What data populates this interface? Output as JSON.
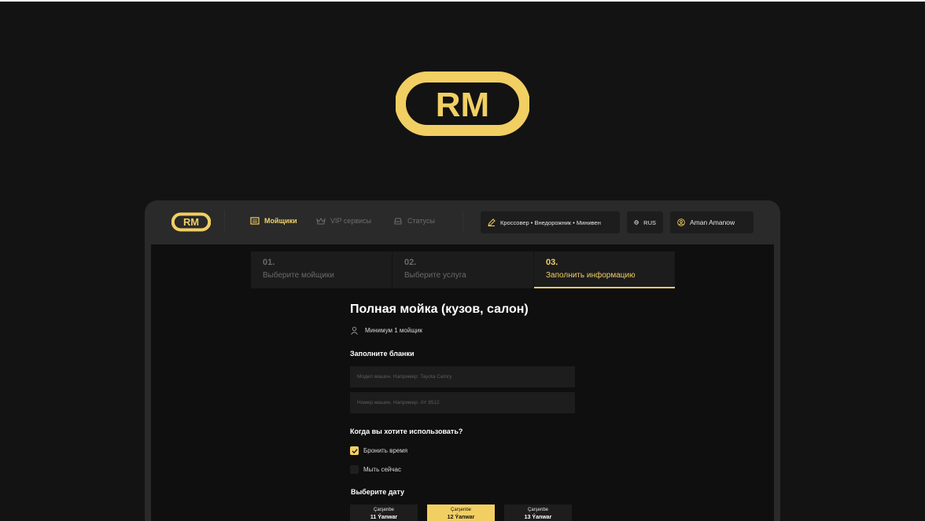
{
  "brand": {
    "logo_text": "RM",
    "accent": "#f2cf63"
  },
  "nav": {
    "items": [
      {
        "label": "Мойщики",
        "icon": "list-icon",
        "active": true
      },
      {
        "label": "VIP сервисы",
        "icon": "crown-icon",
        "active": false
      },
      {
        "label": "Статусы",
        "icon": "car-icon",
        "active": false
      }
    ],
    "car_types": "Кроссовер • Внедорожник • Минивен",
    "language": "RUS",
    "user": "Aman Amanow"
  },
  "steps": [
    {
      "num": "01.",
      "label": "Выберите мойщики",
      "active": false
    },
    {
      "num": "02.",
      "label": "Выберите услуга",
      "active": false
    },
    {
      "num": "03.",
      "label": "Заполнить информацию",
      "active": true
    }
  ],
  "form": {
    "title": "Полная мойка (кузов, салон)",
    "min_workers": "Минимум 1 мойщик",
    "fill_heading": "Заполните бланки",
    "model_placeholder": "Модел машин. Например: Tayota Camry",
    "number_placeholder": "Номер машин. Например: AY 8512",
    "when_heading": "Когда вы хотите использовать?",
    "options": [
      {
        "label": "Бронить время",
        "checked": true
      },
      {
        "label": "Мыть сейчас",
        "checked": false
      }
    ],
    "date_heading": "Выберите дату",
    "dates": [
      {
        "day": "Çarşenbe",
        "date": "11 Ýanwar",
        "selected": false
      },
      {
        "day": "Çarşenbe",
        "date": "12 Ýanwar",
        "selected": true
      },
      {
        "day": "Çarşenbe",
        "date": "13 Ýanwar",
        "selected": false
      }
    ]
  }
}
